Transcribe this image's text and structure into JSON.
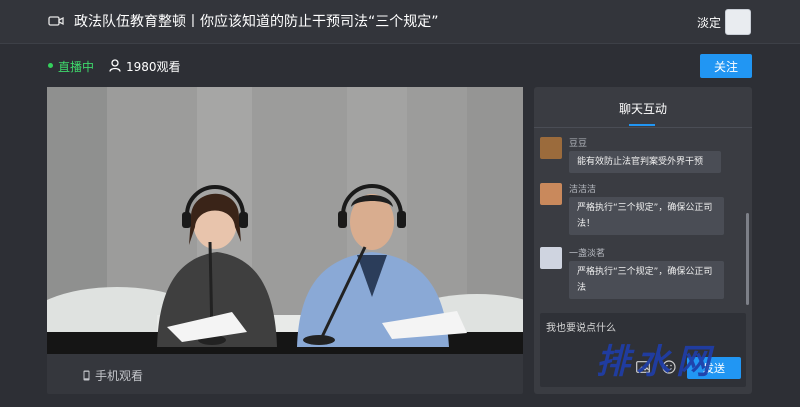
{
  "header": {
    "title": "政法队伍教育整顿丨你应该知道的防止干预司法“三个规定”",
    "user_name": "淡定",
    "camera_icon": "video-camera-icon",
    "avatar_icon": "avatar"
  },
  "status": {
    "live_label": "直播中",
    "viewers": "1980观看",
    "follow_label": "关注",
    "live_color": "#3ed86b"
  },
  "video": {
    "phone_watch_label": "手机观看"
  },
  "chat": {
    "title": "聊天互动",
    "messages": [
      {
        "name": "豆豆",
        "text": "能有效防止法官判案受外界干预"
      },
      {
        "name": "洁洁洁",
        "text": "严格执行“三个规定”，确保公正司法！"
      },
      {
        "name": "一盏淡茗",
        "text": "严格执行“三个规定”，确保公正司法"
      }
    ],
    "input_placeholder": "我也要说点什么",
    "send_label": "发送"
  },
  "watermark": "排水网",
  "colors": {
    "accent": "#2196f3",
    "background": "#2d2f35"
  }
}
